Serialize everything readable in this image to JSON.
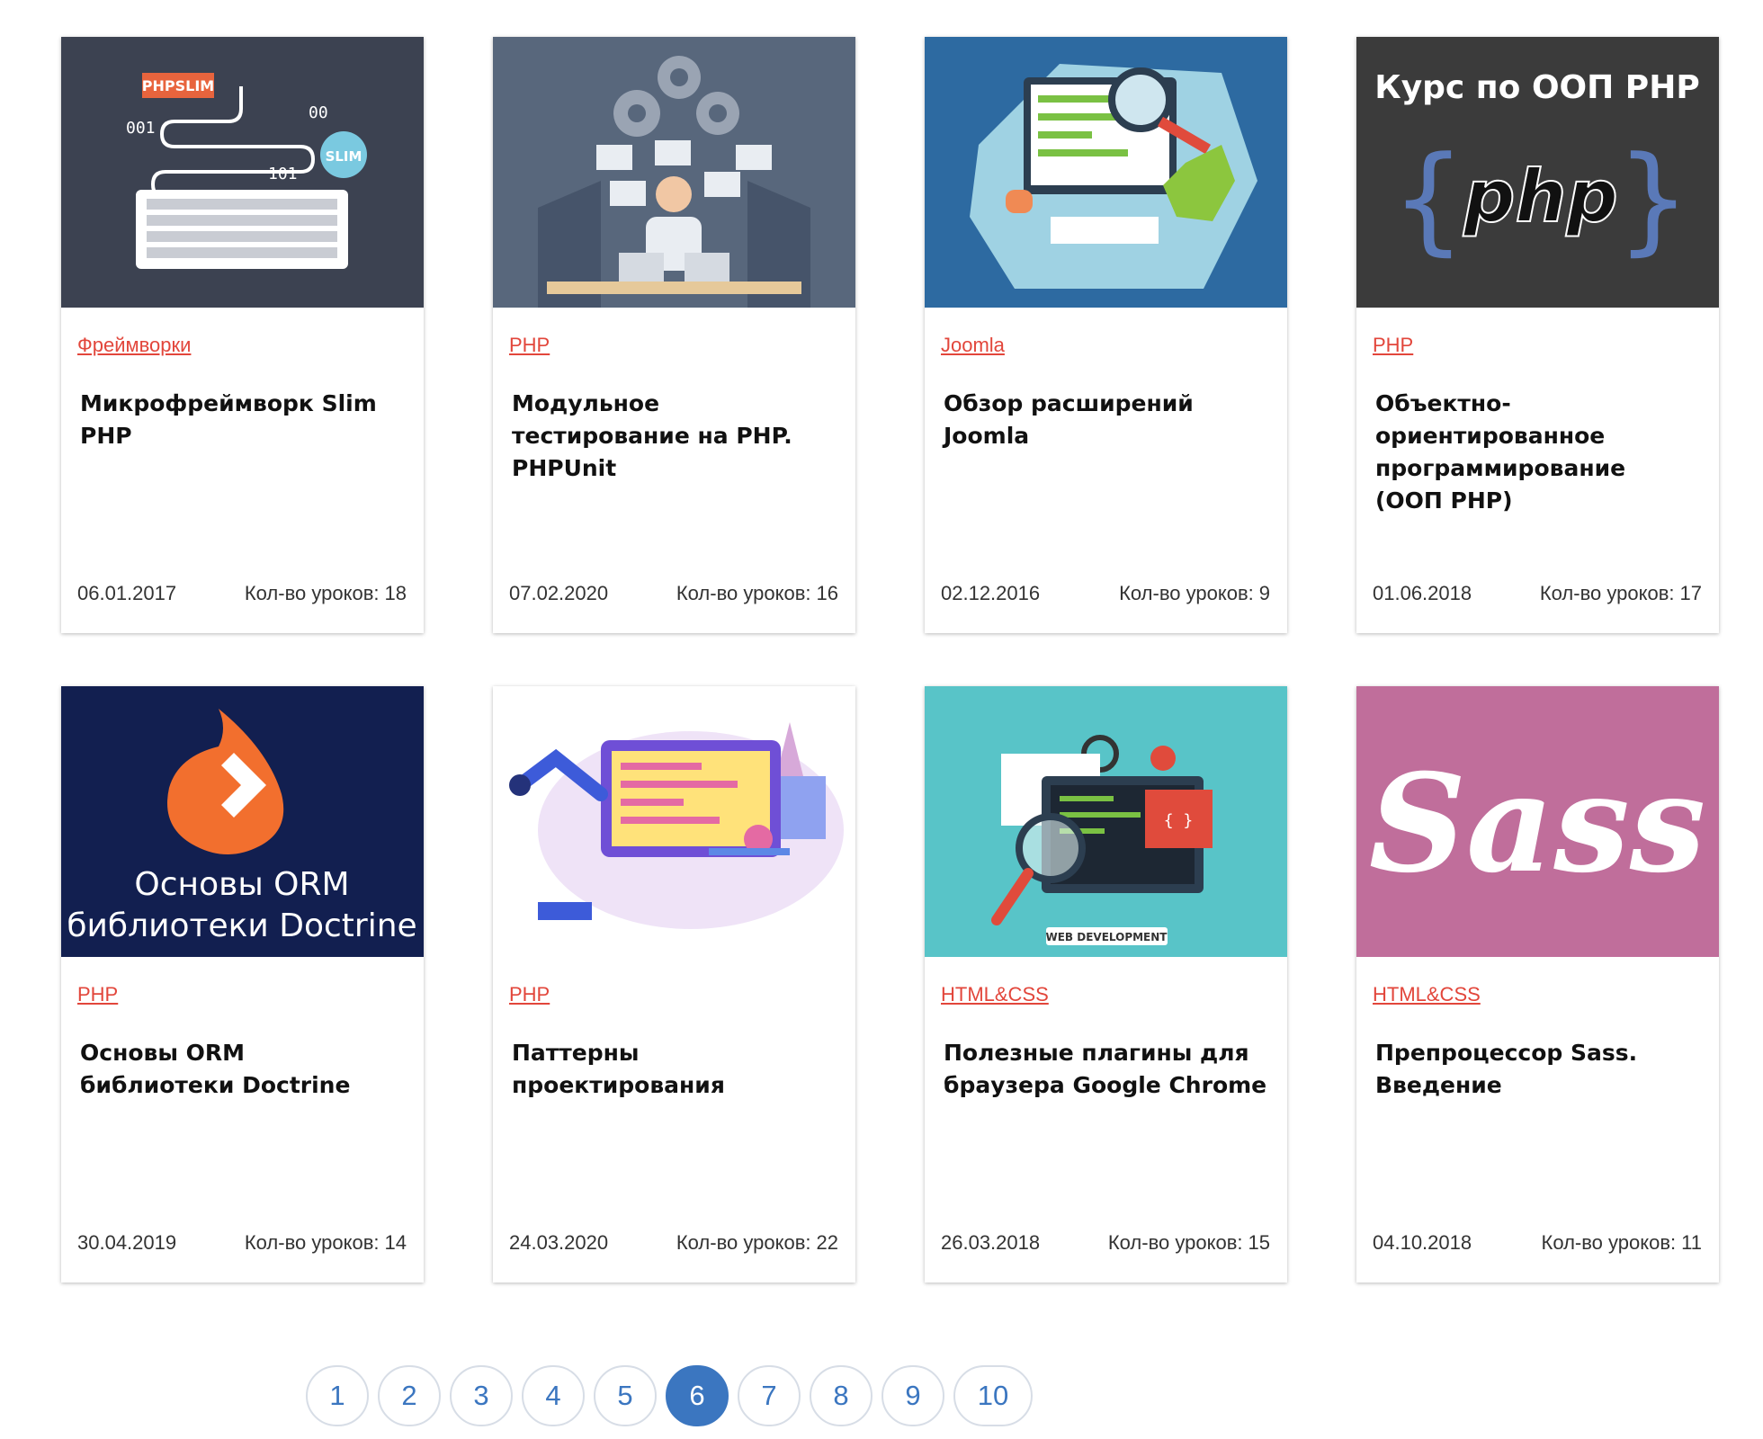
{
  "courses": [
    {
      "category": "Фреймворки",
      "title": "Микрофреймворк Slim PHP",
      "date": "06.01.2017",
      "lessons_label": "Кол-во уроков:",
      "lessons": "18",
      "image_text": [
        "PHPSLIM",
        "001",
        "00",
        "101",
        "SLIM"
      ]
    },
    {
      "category": "PHP",
      "title": "Модульное тестирование на PHP. PHPUnit",
      "date": "07.02.2020",
      "lessons_label": "Кол-во уроков:",
      "lessons": "16"
    },
    {
      "category": "Joomla",
      "title": "Обзор расширений Joomla",
      "date": "02.12.2016",
      "lessons_label": "Кол-во уроков:",
      "lessons": "9"
    },
    {
      "category": "PHP",
      "title": "Объектно-ориентированное программирование (ООП PHP)",
      "date": "01.06.2018",
      "lessons_label": "Кол-во уроков:",
      "lessons": "17",
      "image_text": [
        "Курс по ООП PHP",
        "{",
        "php",
        "}"
      ]
    },
    {
      "category": "PHP",
      "title": "Основы ORM библиотеки Doctrine",
      "date": "30.04.2019",
      "lessons_label": "Кол-во уроков:",
      "lessons": "14",
      "image_text": [
        "Основы ORM",
        "библиотеки Doctrine"
      ]
    },
    {
      "category": "PHP",
      "title": "Паттерны проектирования",
      "date": "24.03.2020",
      "lessons_label": "Кол-во уроков:",
      "lessons": "22"
    },
    {
      "category": "HTML&CSS",
      "title": "Полезные плагины для браузера Google Chrome",
      "date": "26.03.2018",
      "lessons_label": "Кол-во уроков:",
      "lessons": "15",
      "image_text": [
        "WEB DEVELOPMENT",
        "{ }"
      ]
    },
    {
      "category": "HTML&CSS",
      "title": "Препроцессор Sass. Введение",
      "date": "04.10.2018",
      "lessons_label": "Кол-во уроков:",
      "lessons": "11",
      "image_text": [
        "Sass"
      ]
    }
  ],
  "pagination": {
    "pages": [
      "1",
      "2",
      "3",
      "4",
      "5",
      "6",
      "7",
      "8",
      "9",
      "10"
    ],
    "current": "6"
  },
  "colors": {
    "category": "#e2463b",
    "pager_accent": "#3b76c0"
  }
}
